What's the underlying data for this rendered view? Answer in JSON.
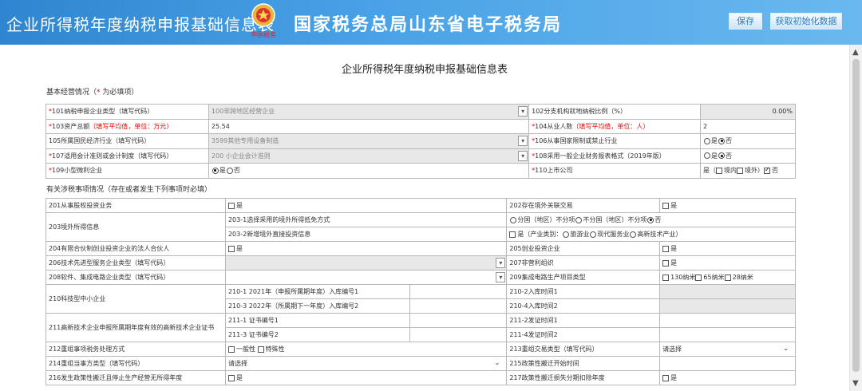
{
  "header": {
    "left_title": "企业所得税年度纳税申报基础信息表",
    "main_title": "国家税务总局山东省电子税务局",
    "emblem_text": "中国税务",
    "save_label": "保存",
    "init_label": "获取初始化数据"
  },
  "doc": {
    "title": "企业所得税年度纳税申报基础信息表",
    "sec1_prefix": "基本经营情况（",
    "sec1_star": "*",
    "sec1_suffix": " 为必填项）",
    "sec2": "有关涉税事项情况（存在或者发生下列事项时必填）"
  },
  "t1": {
    "r1": {
      "star": "*",
      "l": "101纳税申报企业类型（填写代码）",
      "v": "100非跨地区经营企业",
      "l2": "102分支机构就地纳税比例（%）",
      "v2": "0.00%"
    },
    "r2": {
      "star": "*",
      "l": "103资产总额",
      "hint": "（填写平均值，单位：万元）",
      "v": "25.54",
      "star2": "*",
      "l2": "104从业人数",
      "hint2": "（填写平均值，单位：人）",
      "v2": "2"
    },
    "r3": {
      "l": "105所属国民经济行业（填写代码）",
      "v": "3599其他专用设备制造",
      "star2": "*",
      "l2": "106从事国家限制或禁止行业",
      "yes": "是",
      "no": "否"
    },
    "r4": {
      "star": "*",
      "l": "107适用会计准则或会计制度（填写代码）",
      "v": "200 小企业会计准则",
      "star2": "*",
      "l2": "108采用一般企业财务报表格式（2019年版）",
      "yes": "是",
      "no": "否"
    },
    "r5": {
      "star": "*",
      "l": "109小型微利企业",
      "yes": "是",
      "no": "否",
      "star2": "*",
      "l2": "110上市公司",
      "opts": "是（",
      "in": "境内",
      "out": "境外）",
      "no2": "否"
    }
  },
  "t2": {
    "r201": {
      "l": "201从事股权投资业务",
      "c": "是",
      "l2": "202存在境外关联交易",
      "c2": "是"
    },
    "r203": {
      "l": "203境外所得信息",
      "s1": "203-1选择采用的境外所得抵免方式",
      "s1v_a": "分国（地区）不分项",
      "s1v_b": "不分国（地区）不分项",
      "s1v_c": "否",
      "s2": "203-2新增境外直接投资信息",
      "s2v_a": "是（产业类别：",
      "s2v_b": "旅游业",
      "s2v_c": "现代服务业",
      "s2v_d": "高新技术产业）"
    },
    "r204": {
      "l": "204有限合伙制创业投资企业的法人合伙人",
      "c": "是",
      "l2": "205创业投资企业",
      "c2": "是"
    },
    "r206": {
      "l": "206技术先进型服务企业类型（填写代码）",
      "l2": "207非营利组织",
      "c2": "是"
    },
    "r208": {
      "l": "208软件、集成电路企业类型（填写代码）",
      "l2": "209集成电路生产项目类型",
      "o1": "130纳米",
      "o2": "65纳米",
      "o3": "28纳米"
    },
    "r210": {
      "l": "210科技型中小企业",
      "a1": "210-1  2021年（申报所属期年度）入库编号1",
      "a2": "210-2入库时间1",
      "b1": "210-3  2022年（所属期下一年度）入库编号2",
      "b2": "210-4入库时间2"
    },
    "r211": {
      "l": "211高新技术企业申报所属期年度有效的高新技术企业证书",
      "a1": "211-1 证书编号1",
      "a2": "211-2发证时间1",
      "b1": "211-3 证书编号2",
      "b2": "211-4发证时间2"
    },
    "r212": {
      "l": "212重组事项税务处理方式",
      "o1": "一般性",
      "o2": "特殊性",
      "l2": "213重组交易类型（填写代码）",
      "v2": "请选择"
    },
    "r214": {
      "l": "214重组当事方类型（填写代码）",
      "v": "请选择",
      "l2": "215政策性搬迁开始时间"
    },
    "r216": {
      "l": "216发生政策性搬迁且停止生产经营无所得年度",
      "c": "是",
      "l2": "217政策性搬迁损失分期扣除年度",
      "c2": "是"
    }
  }
}
